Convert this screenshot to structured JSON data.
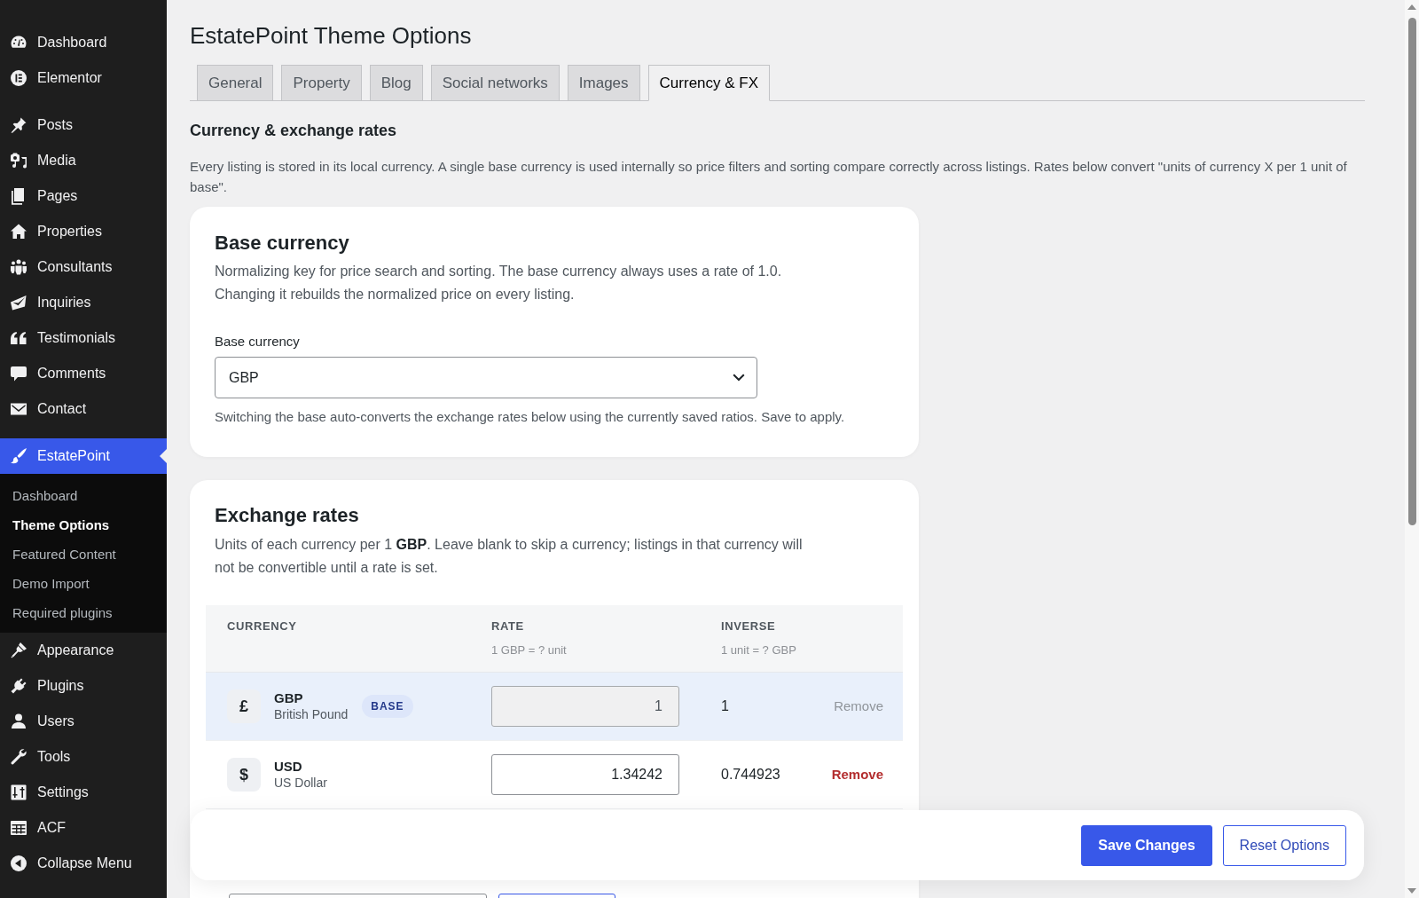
{
  "sidebar": {
    "sections": [
      {
        "items": [
          {
            "label": "Dashboard",
            "selected": false
          },
          {
            "label": "Elementor",
            "selected": false
          }
        ]
      },
      {
        "items": [
          {
            "label": "Posts",
            "selected": false
          },
          {
            "label": "Media",
            "selected": false
          },
          {
            "label": "Pages",
            "selected": false
          },
          {
            "label": "Properties",
            "selected": false
          },
          {
            "label": "Consultants",
            "selected": false
          },
          {
            "label": "Inquiries",
            "selected": false
          },
          {
            "label": "Testimonials",
            "selected": false
          },
          {
            "label": "Comments",
            "selected": false
          },
          {
            "label": "Contact",
            "selected": false
          }
        ]
      },
      {
        "items": [
          {
            "label": "EstatePoint",
            "selected": true,
            "submenu": [
              {
                "label": "Dashboard",
                "selected": false
              },
              {
                "label": "Theme Options",
                "selected": true
              },
              {
                "label": "Featured Content",
                "selected": false
              },
              {
                "label": "Demo Import",
                "selected": false
              },
              {
                "label": "Required plugins",
                "selected": false
              }
            ]
          },
          {
            "label": "Appearance",
            "selected": false
          },
          {
            "label": "Plugins",
            "selected": false
          },
          {
            "label": "Users",
            "selected": false
          },
          {
            "label": "Tools",
            "selected": false
          },
          {
            "label": "Settings",
            "selected": false
          },
          {
            "label": "ACF",
            "selected": false
          },
          {
            "label": "Collapse Menu",
            "selected": false
          }
        ]
      }
    ]
  },
  "page": {
    "title": "EstatePoint Theme Options"
  },
  "tabs": [
    {
      "label": "General",
      "selected": false
    },
    {
      "label": "Property",
      "selected": false
    },
    {
      "label": "Blog",
      "selected": false
    },
    {
      "label": "Social networks",
      "selected": false
    },
    {
      "label": "Images",
      "selected": false
    },
    {
      "label": "Currency & FX",
      "selected": true
    }
  ],
  "section": {
    "title": "Currency & exchange rates",
    "description": "Every listing is stored in its local currency. A single base currency is used internally so price filters and sorting compare correctly across listings. Rates below convert \"units of currency X per 1 unit of base\"."
  },
  "base_currency": {
    "title": "Base currency",
    "description": "Normalizing key for price search and sorting. The base currency always uses a rate of 1.0. Changing it rebuilds the normalized price on every listing.",
    "field_label": "Base currency",
    "select": {
      "value": "GBP"
    },
    "help": "Switching the base auto-converts the exchange rates below using the currently saved ratios. Save to apply."
  },
  "exchange_rates": {
    "title": "Exchange rates",
    "description": "Units of each currency per 1 **GBP**. Leave blank to skip a currency; listings in that currency will not be convertible until a rate is set.",
    "table": {
      "columns": [
        {
          "label": "CURRENCY"
        },
        {
          "label": "RATE",
          "sublabel": "1 GBP = ? unit"
        },
        {
          "label": "INVERSE",
          "sublabel": "1 unit = ? GBP"
        }
      ],
      "rows": [
        {
          "symbol": "£",
          "code": "GBP",
          "name": "British Pound",
          "badge": "BASE",
          "highlighted": true,
          "rate_field": {
            "value": "1",
            "disabled": true
          },
          "inverse": "1",
          "remove": {
            "label": "Remove",
            "disabled": true
          }
        },
        {
          "symbol": "$",
          "code": "USD",
          "name": "US Dollar",
          "highlighted": false,
          "rate_field": {
            "value": "1.34242",
            "disabled": false
          },
          "inverse": "0.744923",
          "remove": {
            "label": "Remove",
            "disabled": false
          }
        }
      ]
    }
  },
  "actions": [
    {
      "label": "Save Changes",
      "kind": "primary"
    },
    {
      "label": "Reset Options",
      "kind": "secondary"
    }
  ]
}
